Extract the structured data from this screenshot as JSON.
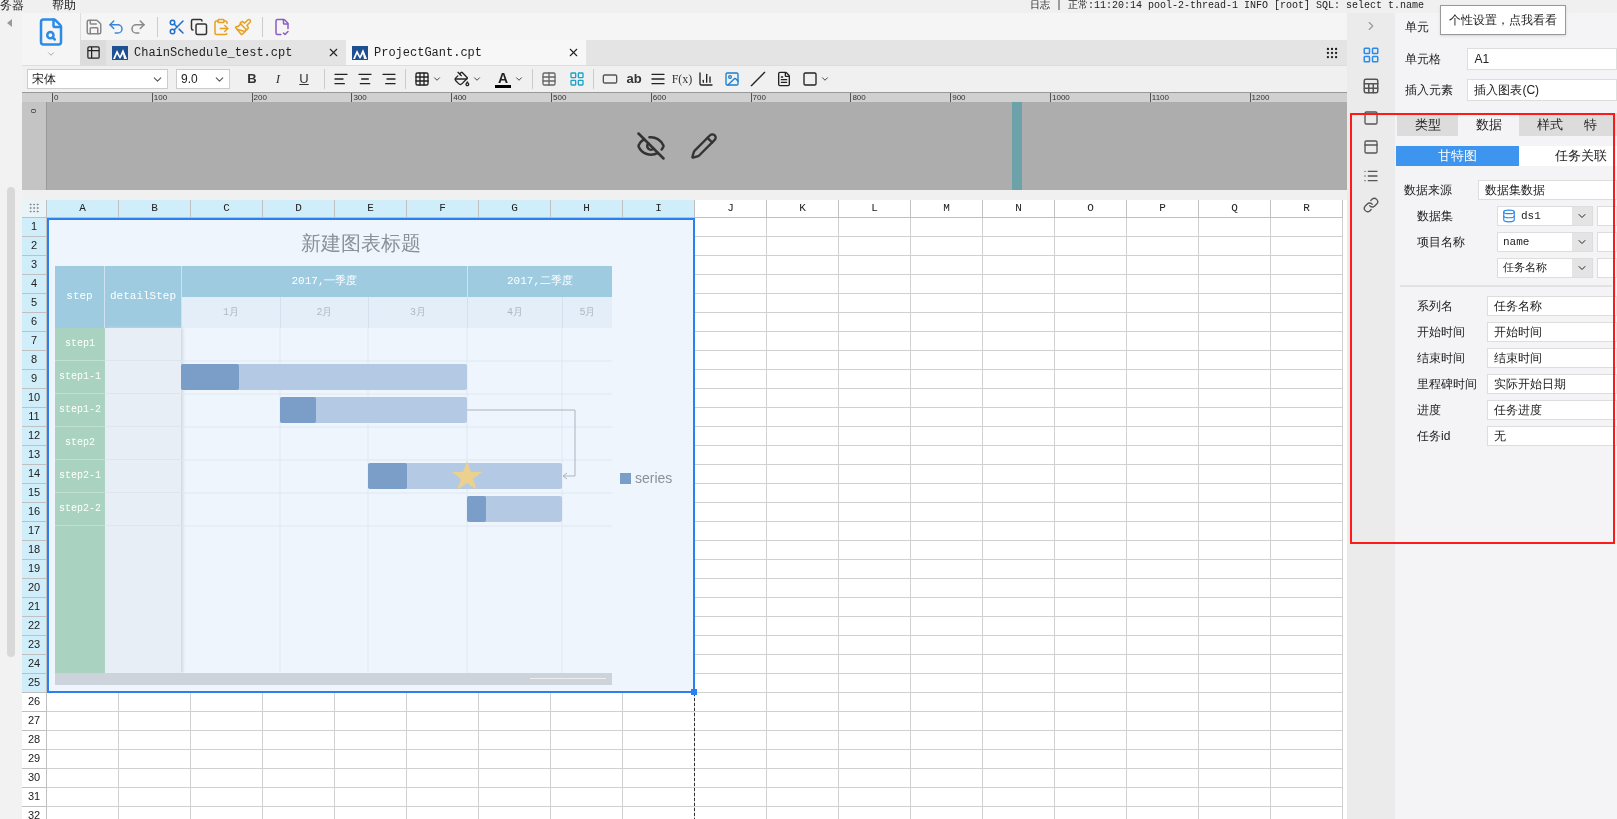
{
  "menu_bar": {
    "items": [
      "务器",
      "帮助"
    ],
    "log_text": "日志 | 正常:11:20:14 pool-2-thread-1 INFO [root] SQL: select t.name"
  },
  "tooltip": "个性设置，点我看看",
  "file_tabs": [
    {
      "label": "ChainSchedule_test.cpt",
      "selected": false
    },
    {
      "label": "ProjectGant.cpt",
      "selected": true
    }
  ],
  "format_toolbar": {
    "font": "宋体",
    "size": "9.0",
    "bold": "B",
    "italic": "I",
    "underline": "U",
    "font_color": "A",
    "text_field": "ab",
    "formula": "F(x)"
  },
  "ruler_marks": [
    "0",
    "100",
    "200",
    "300",
    "400",
    "500",
    "600",
    "700",
    "800",
    "900",
    "1000",
    "1100",
    "1200"
  ],
  "vertical_ruler_mark": "0",
  "sheet": {
    "columns": [
      {
        "label": "A",
        "selected": true
      },
      {
        "label": "B",
        "selected": true
      },
      {
        "label": "C",
        "selected": true
      },
      {
        "label": "D",
        "selected": true
      },
      {
        "label": "E",
        "selected": true
      },
      {
        "label": "F",
        "selected": true
      },
      {
        "label": "G",
        "selected": true
      },
      {
        "label": "H",
        "selected": true
      },
      {
        "label": "I",
        "selected": true
      },
      {
        "label": "J",
        "selected": false
      },
      {
        "label": "K",
        "selected": false
      },
      {
        "label": "L",
        "selected": false
      },
      {
        "label": "M",
        "selected": false
      },
      {
        "label": "N",
        "selected": false
      },
      {
        "label": "O",
        "selected": false
      },
      {
        "label": "P",
        "selected": false
      },
      {
        "label": "Q",
        "selected": false
      },
      {
        "label": "R",
        "selected": false
      }
    ],
    "rows": [
      {
        "label": "1",
        "selected": true
      },
      {
        "label": "2",
        "selected": true
      },
      {
        "label": "3",
        "selected": true
      },
      {
        "label": "4",
        "selected": true
      },
      {
        "label": "5",
        "selected": true
      },
      {
        "label": "6",
        "selected": true
      },
      {
        "label": "7",
        "selected": true
      },
      {
        "label": "8",
        "selected": true
      },
      {
        "label": "9",
        "selected": true
      },
      {
        "label": "10",
        "selected": true
      },
      {
        "label": "11",
        "selected": true
      },
      {
        "label": "12",
        "selected": true
      },
      {
        "label": "13",
        "selected": true
      },
      {
        "label": "14",
        "selected": true
      },
      {
        "label": "15",
        "selected": true
      },
      {
        "label": "16",
        "selected": true
      },
      {
        "label": "17",
        "selected": true
      },
      {
        "label": "18",
        "selected": true
      },
      {
        "label": "19",
        "selected": true
      },
      {
        "label": "20",
        "selected": true
      },
      {
        "label": "21",
        "selected": true
      },
      {
        "label": "22",
        "selected": true
      },
      {
        "label": "23",
        "selected": true
      },
      {
        "label": "24",
        "selected": true
      },
      {
        "label": "25",
        "selected": true
      },
      {
        "label": "26",
        "selected": false
      },
      {
        "label": "27",
        "selected": false
      },
      {
        "label": "28",
        "selected": false
      },
      {
        "label": "29",
        "selected": false
      },
      {
        "label": "30",
        "selected": false
      },
      {
        "label": "31",
        "selected": false
      },
      {
        "label": "32",
        "selected": false
      }
    ]
  },
  "chart": {
    "title": "新建图表标题",
    "header_columns": [
      "step",
      "detailStep"
    ],
    "quarters": [
      "2017,一季度",
      "2017,二季度"
    ],
    "months": [
      "1月",
      "2月",
      "3月",
      "4月",
      "5月"
    ],
    "tasks": [
      "step1",
      "step1-1",
      "step1-2",
      "step2",
      "step2-1",
      "step2-2"
    ],
    "legend": "series"
  },
  "properties": {
    "header": "单元",
    "cell_label": "单元格",
    "cell_value": "A1",
    "insert_label": "插入元素",
    "insert_value": "插入图表(C)",
    "tabs": [
      {
        "label": "类型",
        "selected": false
      },
      {
        "label": "数据",
        "selected": true
      },
      {
        "label": "样式",
        "selected": false
      },
      {
        "label": "特",
        "selected": false
      }
    ],
    "subtabs": [
      {
        "label": "甘特图",
        "selected": true
      },
      {
        "label": "任务关联",
        "selected": false
      }
    ],
    "source": {
      "label": "数据来源",
      "value": "数据集数据"
    },
    "selects": [
      {
        "kind": "dataset",
        "label": "数据集",
        "value": "ds1"
      },
      {
        "kind": "select",
        "label": "项目名称",
        "value": "name"
      },
      {
        "kind": "select",
        "value": "任务名称"
      }
    ],
    "mapping": [
      {
        "label": "系列名",
        "value": "任务名称"
      },
      {
        "label": "开始时间",
        "value": "开始时间"
      },
      {
        "label": "结束时间",
        "value": "结束时间"
      },
      {
        "label": "里程碑时间",
        "value": "实际开始日期"
      },
      {
        "label": "进度",
        "value": "任务进度"
      },
      {
        "label": "任务id",
        "value": "无"
      }
    ]
  }
}
